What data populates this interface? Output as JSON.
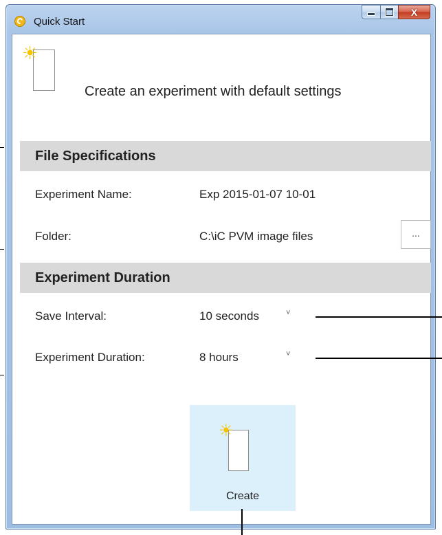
{
  "window": {
    "title": "Quick Start",
    "close_glyph": "X"
  },
  "header": {
    "text": "Create an experiment with default settings",
    "icon": "new-document-sun-icon"
  },
  "file_specifications": {
    "heading": "File Specifications",
    "experiment_name_label": "Experiment Name:",
    "experiment_name_value": "Exp 2015-01-07 10-01",
    "folder_label": "Folder:",
    "folder_value": "C:\\iC PVM image files",
    "browse_label": "..."
  },
  "experiment_duration": {
    "heading": "Experiment Duration",
    "save_interval_label": "Save Interval:",
    "save_interval_value": "10 seconds",
    "duration_label": "Experiment Duration:",
    "duration_value": "8 hours",
    "dropdown_glyph": "˅"
  },
  "create": {
    "label": "Create",
    "icon": "new-document-sun-icon"
  },
  "colors": {
    "section_bg": "#d9d9d9",
    "create_tile_bg": "#dcf0fb",
    "sun": "#f5c400"
  }
}
